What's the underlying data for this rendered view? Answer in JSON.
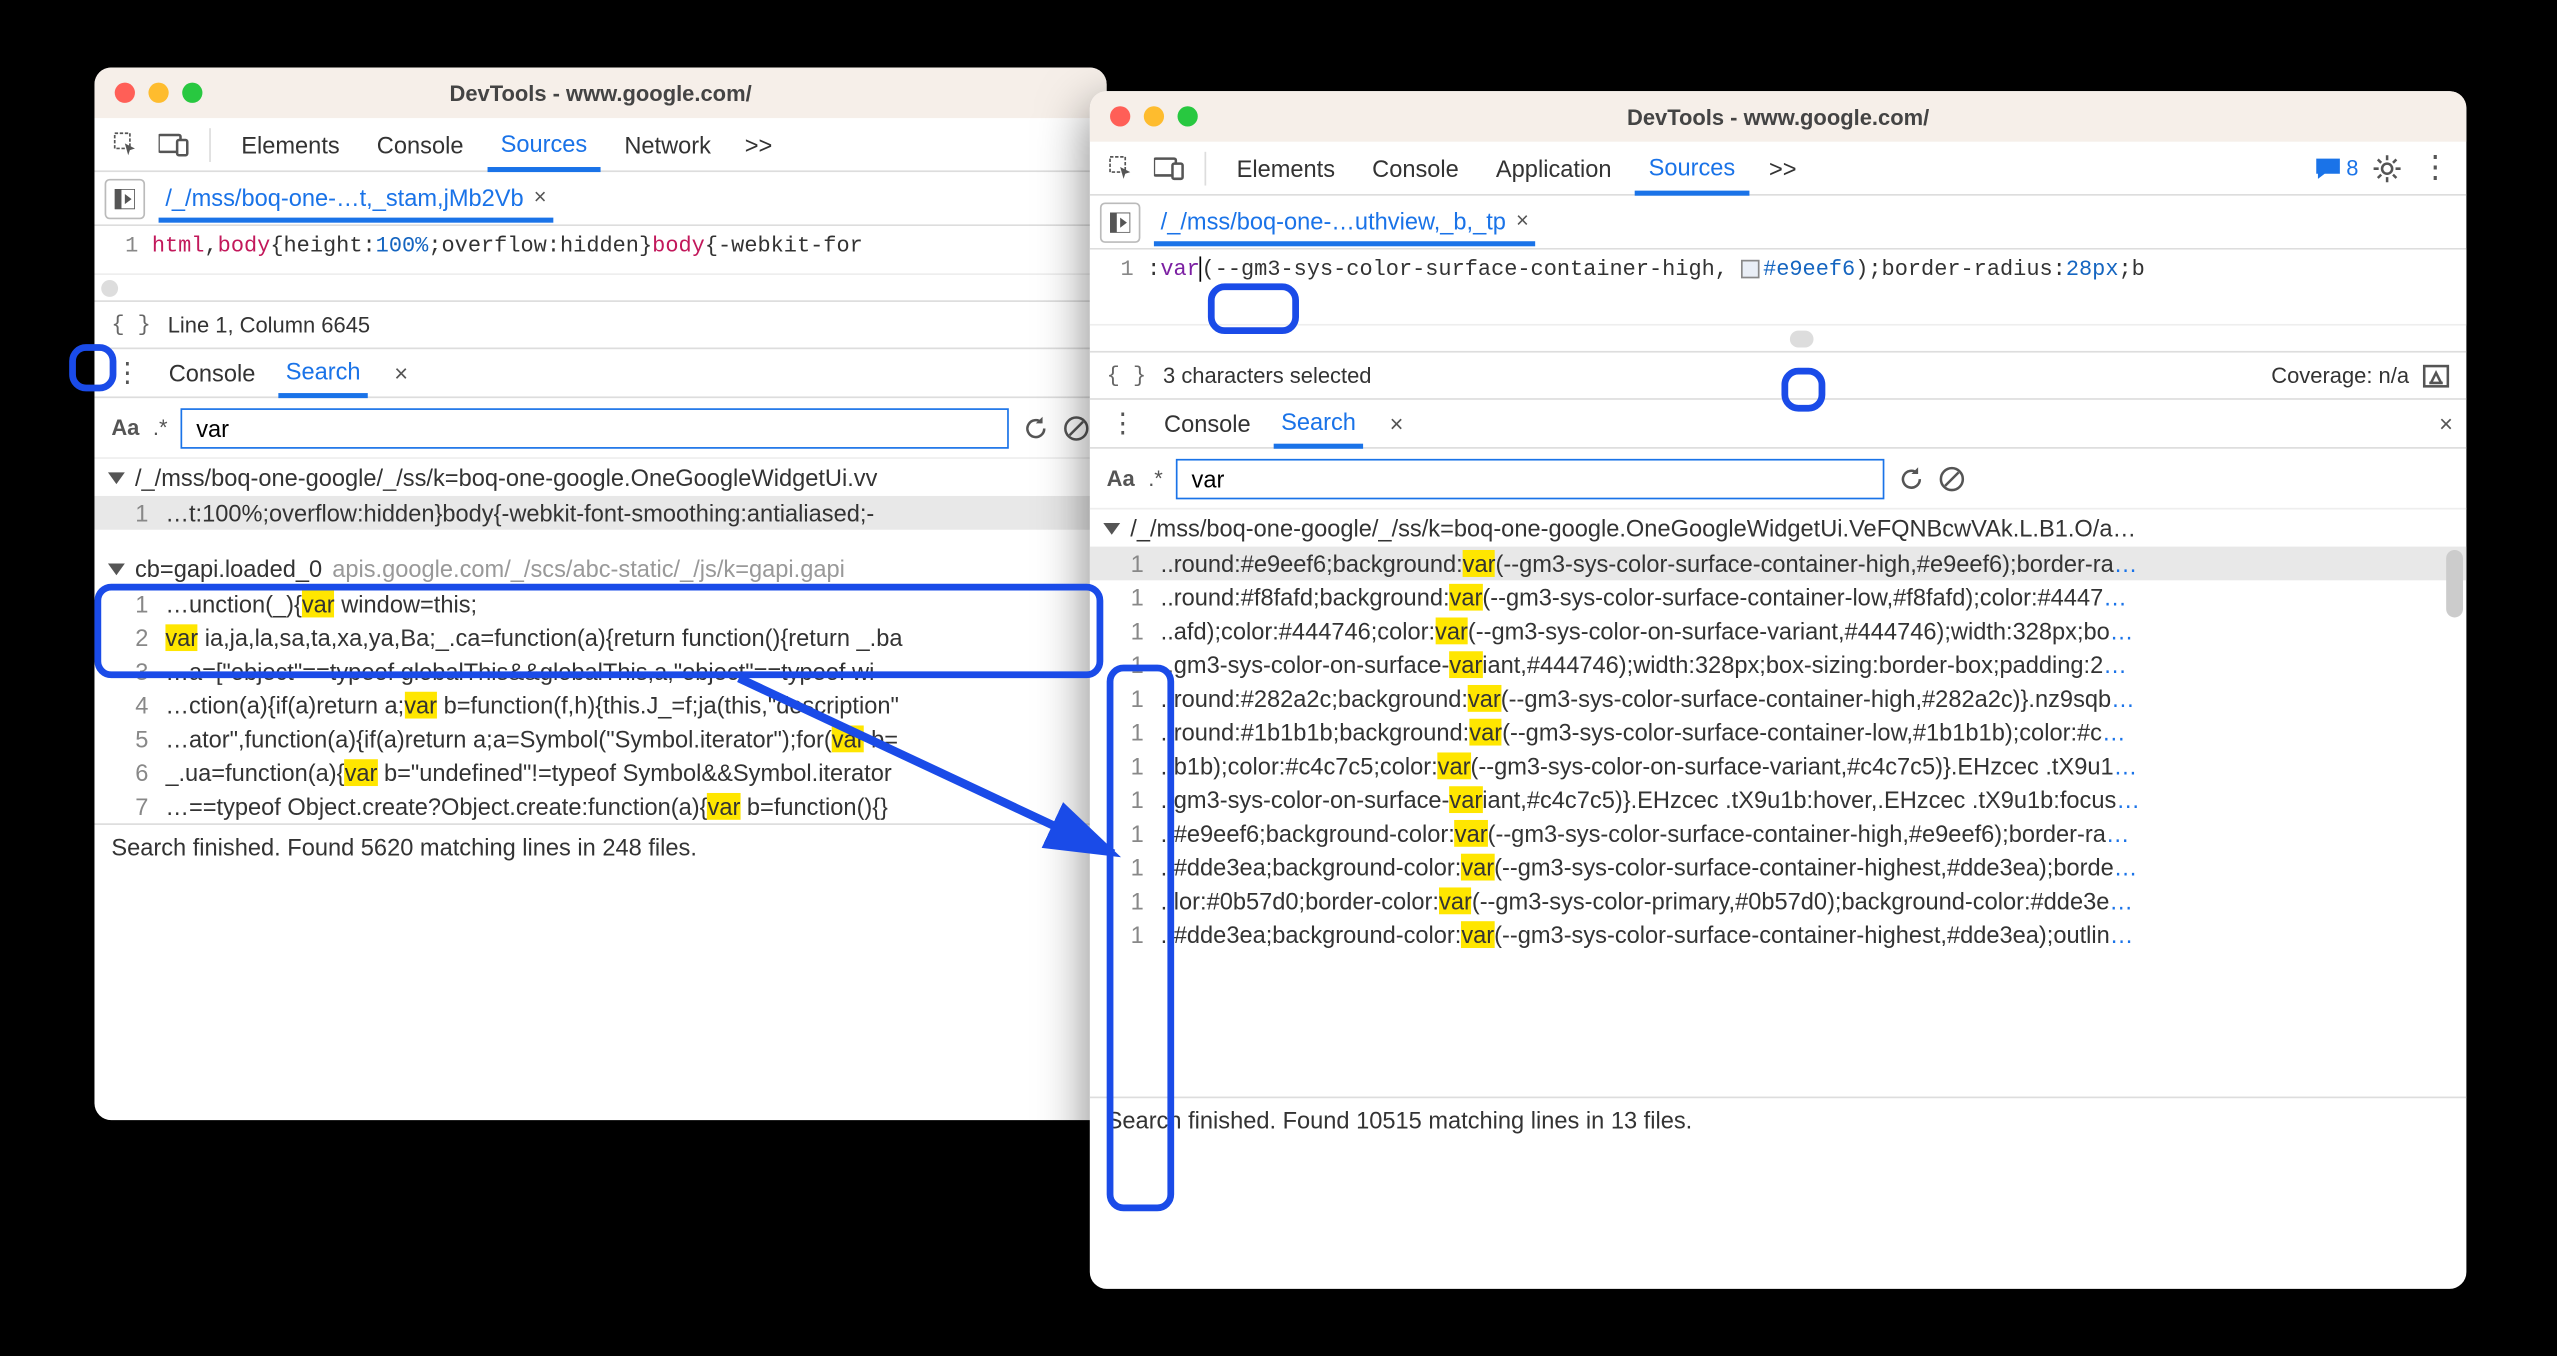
{
  "left": {
    "title": "DevTools - www.google.com/",
    "tabs": [
      "Elements",
      "Console",
      "Sources",
      "Network"
    ],
    "active_tab": "Sources",
    "more": ">>",
    "file_tab": "/_/mss/boq-one-…t,_stam,jMb2Vb",
    "file_close": "×",
    "code_tokens": {
      "sel1": "html",
      "sel2": "body",
      "open": "{",
      "prop1": "height",
      "colon": ":",
      "val1": "100%",
      "semi": ";",
      "prop2": "overflow",
      "val2": "hidden",
      "close": "}",
      "sel3": "body",
      "open2": "{",
      "prop3": "-webkit-for"
    },
    "line_num": "1",
    "status_line": "Line 1, Column 6645",
    "braces": "{ }",
    "drawer_tabs": [
      "Console",
      "Search"
    ],
    "drawer_active": "Search",
    "search_opts": {
      "aa": "Aa",
      "regex": ".*"
    },
    "search_value": "var",
    "results": {
      "file1": {
        "path": "/_/mss/boq-one-google/_/ss/k=boq-one-google.OneGoogleWidgetUi.vv"
      },
      "row1": {
        "n": "1",
        "pre": "…t:100%;overflow:hidden}body{-webkit-font-smoothing:antialiased;-"
      },
      "file2": {
        "path": "cb=gapi.loaded_0",
        "origin": "apis.google.com/_/scs/abc-static/_/js/k=gapi.gapi"
      },
      "rows2": [
        {
          "n": "1",
          "pre": "…unction(_){",
          "hl": "var",
          "post": " window=this;"
        },
        {
          "n": "2",
          "pre": "",
          "hl": "var",
          "post": " ia,ja,la,sa,ta,xa,ya,Ba;_.ca=function(a){return function(){return _.ba"
        },
        {
          "n": "3",
          "pre": "…a=[\"object\"==typeof globalThis&&globalThis,a,\"object\"==typeof wi",
          "no_hl": true
        },
        {
          "n": "4",
          "pre": "…ction(a){if(a)return a;",
          "hl": "var",
          "post": " b=function(f,h){this.J_=f;ja(this,\"description\""
        },
        {
          "n": "5",
          "pre": "…ator\",function(a){if(a)return a;a=Symbol(\"Symbol.iterator\");for(",
          "hl": "var",
          "post": " b="
        },
        {
          "n": "6",
          "pre": "_.ua=function(a){",
          "hl": "var",
          "post": " b=\"undefined\"!=typeof Symbol&&Symbol.iterator"
        },
        {
          "n": "7",
          "pre": "…==typeof Object.create?Object.create:function(a){",
          "hl": "var",
          "post": " b=function(){}"
        }
      ]
    },
    "footer": "Search finished.  Found 5620 matching lines in 248 files."
  },
  "right": {
    "title": "DevTools - www.google.com/",
    "tabs": [
      "Elements",
      "Console",
      "Application",
      "Sources"
    ],
    "active_tab": "Sources",
    "more": ">>",
    "msg_count": "8",
    "file_tab": "/_/mss/boq-one-…uthview,_b,_tp",
    "file_close": "×",
    "line_num": "1",
    "code_tokens": {
      "colon": ":",
      "var": "var",
      "open": "(",
      "name": "--gm3-sys-color-surface-container-high",
      "comma": ", ",
      "hex": "#e9eef6",
      "close": ")",
      "semi": ";",
      "prop": "border-radius",
      "colon2": ":",
      "val": "28px",
      "semi2": ";",
      "trail": "b"
    },
    "status_line": "3 characters selected",
    "coverage": "Coverage: n/a",
    "braces": "{ }",
    "drawer_tabs": [
      "Console",
      "Search"
    ],
    "drawer_active": "Search",
    "search_opts": {
      "aa": "Aa",
      "regex": ".*"
    },
    "search_value": "var",
    "results": {
      "file1": {
        "path": "/_/mss/boq-one-google/_/ss/k=boq-one-google.OneGoogleWidgetUi.VeFQNBcwVAk.L.B1.O/a…"
      },
      "rows": [
        {
          "n": "1",
          "pre": "..round:#e9eef6;background:",
          "hl": "var",
          "post": "(--gm3-sys-color-surface-container-high,#e9eef6);border-ra",
          "selected": true
        },
        {
          "n": "1",
          "pre": "..round:#f8fafd;background:",
          "hl": "var",
          "post": "(--gm3-sys-color-surface-container-low,#f8fafd);color:#4447"
        },
        {
          "n": "1",
          "pre": "..afd);color:#444746;color:",
          "hl": "var",
          "post": "(--gm3-sys-color-on-surface-variant,#444746);width:328px;bo"
        },
        {
          "n": "1",
          "pre": "..gm3-sys-color-on-surface-",
          "hl": "var",
          "post": "iant,#444746);width:328px;box-sizing:border-box;padding:2"
        },
        {
          "n": "1",
          "pre": "..round:#282a2c;background:",
          "hl": "var",
          "post": "(--gm3-sys-color-surface-container-high,#282a2c)}.nz9sqb"
        },
        {
          "n": "1",
          "pre": "..round:#1b1b1b;background:",
          "hl": "var",
          "post": "(--gm3-sys-color-surface-container-low,#1b1b1b);color:#c"
        },
        {
          "n": "1",
          "pre": "..b1b);color:#c4c7c5;color:",
          "hl": "var",
          "post": "(--gm3-sys-color-on-surface-variant,#c4c7c5)}.EHzcec .tX9u1"
        },
        {
          "n": "1",
          "pre": "..gm3-sys-color-on-surface-",
          "hl": "var",
          "post": "iant,#c4c7c5)}.EHzcec .tX9u1b:hover,.EHzcec .tX9u1b:focus"
        },
        {
          "n": "1",
          "pre": "..#e9eef6;background-color:",
          "hl": "var",
          "post": "(--gm3-sys-color-surface-container-high,#e9eef6);border-ra"
        },
        {
          "n": "1",
          "pre": "..#dde3ea;background-color:",
          "hl": "var",
          "post": "(--gm3-sys-color-surface-container-highest,#dde3ea);borde"
        },
        {
          "n": "1",
          "pre": "..lor:#0b57d0;border-color:",
          "hl": "var",
          "post": "(--gm3-sys-color-primary,#0b57d0);background-color:#dde3e"
        },
        {
          "n": "1",
          "pre": "..#dde3ea;background-color:",
          "hl": "var",
          "post": "(--gm3-sys-color-surface-container-highest,#dde3ea);outlin"
        }
      ]
    },
    "footer": "Search finished.  Found 10515 matching lines in 13 files."
  },
  "icons": {
    "vdots": "⋮"
  }
}
